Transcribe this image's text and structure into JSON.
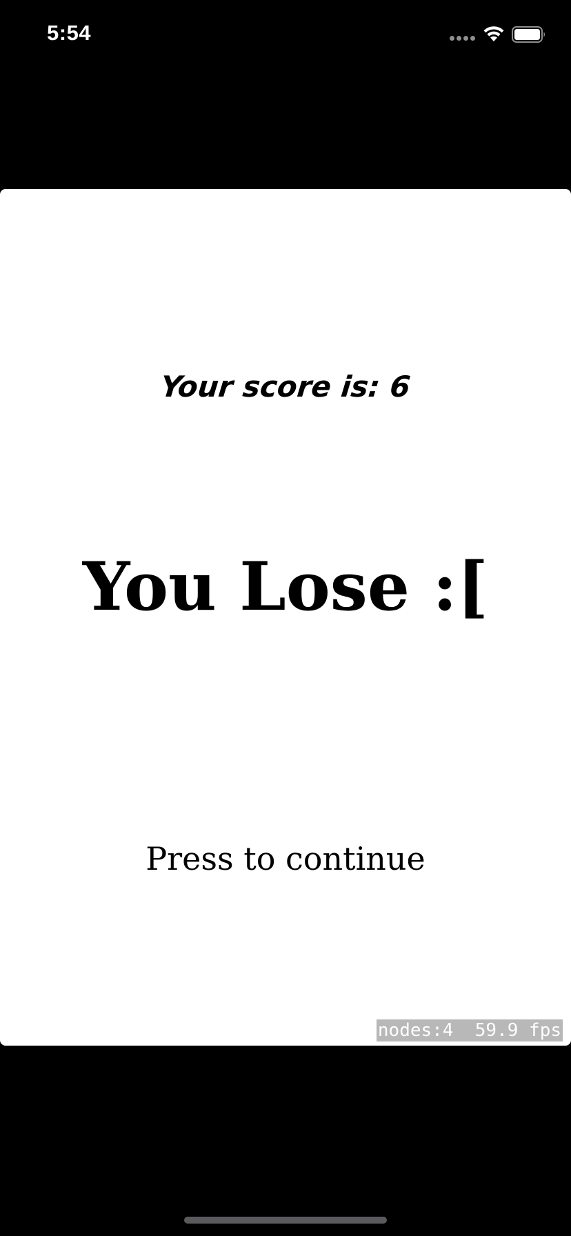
{
  "status_bar": {
    "time": "5:54",
    "signal_icon": "cellular-signal-icon",
    "wifi_icon": "wifi-icon",
    "battery_icon": "battery-icon"
  },
  "game_over_screen": {
    "score_text": "Your score is: 6",
    "result_text": "You Lose :[",
    "continue_text": "Press to continue",
    "debug_stats": "nodes:4  59.9 fps"
  },
  "colors": {
    "background": "#000000",
    "scene": "#ffffff",
    "text": "#000000",
    "debug_bg": "#b8b8b8"
  }
}
